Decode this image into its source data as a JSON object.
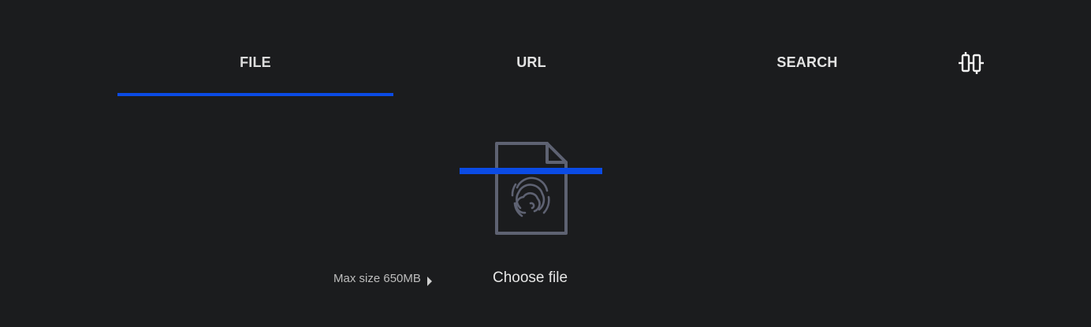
{
  "tabs": [
    {
      "label": "FILE",
      "active": true
    },
    {
      "label": "URL",
      "active": false
    },
    {
      "label": "SEARCH",
      "active": false
    }
  ],
  "toolbar": {
    "compare_icon": "compare-icon"
  },
  "upload": {
    "file_icon": "fingerprint-file-icon",
    "max_size_label": "Max size 650MB",
    "choose_file_label": "Choose file"
  },
  "colors": {
    "background": "#1b1c1e",
    "accent": "#0b4be5",
    "icon_gray": "#5e6272"
  }
}
